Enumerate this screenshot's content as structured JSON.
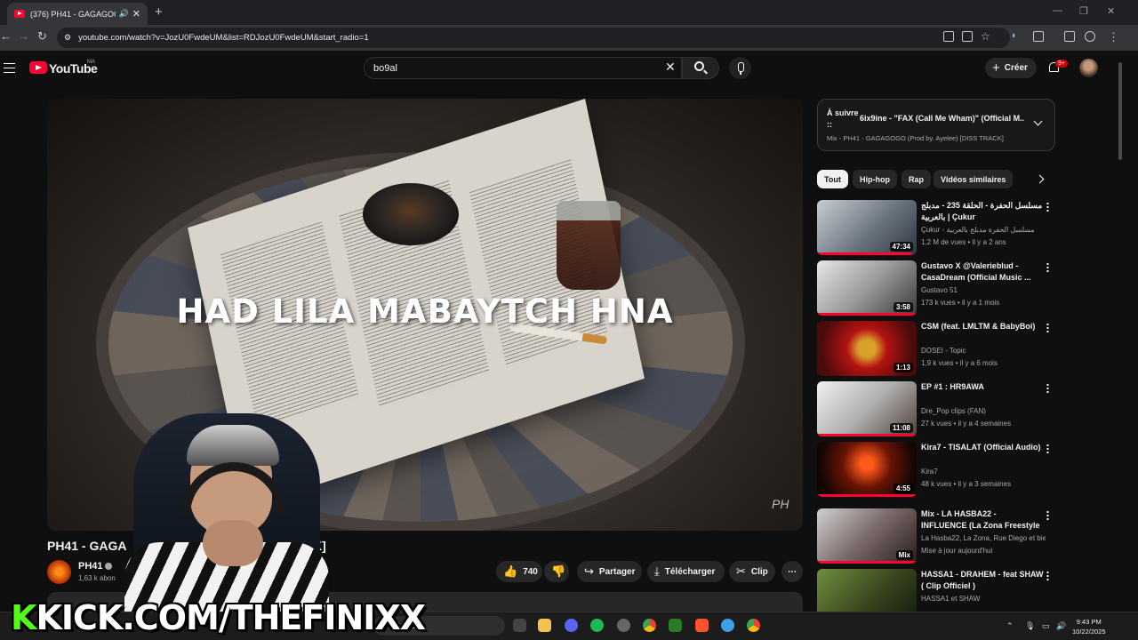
{
  "browser": {
    "tab_title": "(376) PH41 - GAGAGOGO (",
    "url": "youtube.com/watch?v=JozU0FwdeUM&list=RDJozU0FwdeUM&start_radio=1"
  },
  "youtube": {
    "logo_text": "YouTube",
    "country_code": "MA",
    "search_value": "bo9al",
    "create_label": "Créer",
    "notif_badge": "9+"
  },
  "player": {
    "overlay_text": "HAD LILA MABAYTCH HNA",
    "watermark": "PH"
  },
  "video": {
    "title_start": "PH41 - GAGAG",
    "title_end": "K]",
    "channel": "PH41",
    "subs": "1,63 k abon",
    "likes": "740",
    "share_label": "Partager",
    "download_label": "Télécharger",
    "clip_label": "Clip"
  },
  "up_next": {
    "label": "À suivre ::",
    "title": "6ix9ine - \"FAX (Call Me Wham)\" (Official M...",
    "sub": "Mix - PH41 - GAGAGOGO (Prod by. Ayelee) [DISS TRACK]"
  },
  "chips": [
    "Tout",
    "Hip-hop",
    "Rap",
    "Vidéos similaires"
  ],
  "recs": [
    {
      "title": "مسلسل الحفرة - الحلقة 235 - مدبلج بالعربية | Çukur",
      "channel": "Çukur - مسلسل الحفرة مدبلج بالعربية",
      "meta": "1,2 M de vues • il y a 2 ans",
      "duration": "47:34",
      "progress": 0.95
    },
    {
      "title": "Gustavo X @Valerieblud - CasaDream (Official Music ...",
      "channel": "Gustavo 51",
      "meta": "173 k vues • il y a 1 mois",
      "duration": "3:58",
      "progress": 1.0
    },
    {
      "title": "CSM (feat. LMLTM & BabyBoi)",
      "channel": "DOSEI - Topic",
      "meta": "1,9 k vues • il y a 6 mois",
      "duration": "1:13",
      "progress": 0
    },
    {
      "title": "EP #1 : HR9AWA",
      "channel": "Dre_Pop clips (FAN)",
      "meta": "27 k vues • il y a 4 semaines",
      "duration": "11:08",
      "progress": 1.0
    },
    {
      "title": "Kira7 - TISALAT (Official Audio)",
      "channel": "Kira7",
      "meta": "48 k vues • il y a 3 semaines",
      "duration": "4:55",
      "progress": 1.0
    },
    {
      "title": "Mix - LA HASBA22 - INFLUENCE (La Zona Freestyle #16) | ...",
      "channel": "La Hasba22, La Zona, Rue Diego et bien ...",
      "meta": "Mise à jour aujourd'hui",
      "duration": "Mix",
      "progress": 1.0
    },
    {
      "title": "HASSA1 - DRAHEM - feat SHAW ( Clip Officiel )",
      "channel": "HASSA1 et SHAW",
      "meta": "",
      "duration": "",
      "progress": 0
    }
  ],
  "overlay_banner": {
    "k": "K",
    "rest": "KICK.COM/THEFINIXX"
  },
  "taskbar": {
    "search_label": "Search",
    "time": "9:43 PM",
    "date": "10/22/2025"
  },
  "colors": {
    "accent": "#ff0033",
    "kick_green": "#53fc18",
    "bg": "#0f0f0f"
  }
}
